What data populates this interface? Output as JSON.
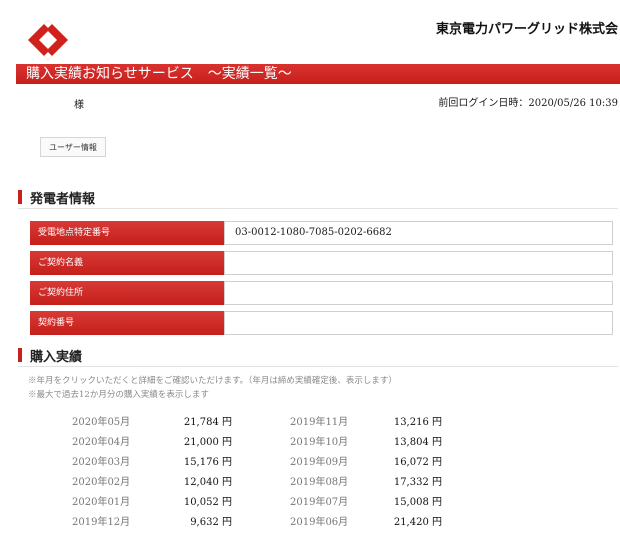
{
  "header": {
    "logo_icon": "tepco-logo-icon",
    "company_name": "東京電力パワーグリッド株式会",
    "brand_color": "#c8201c"
  },
  "banner": {
    "title": "購入実績お知らせサービス　〜実績一覧〜"
  },
  "user": {
    "name_suffix": "様",
    "last_login": "前回ログイン日時：2020/05/26 10:39"
  },
  "nav": {
    "user_info_button": "ユーザー情報"
  },
  "generator_info": {
    "section_title": "発電者情報",
    "rows": [
      {
        "label": "受電地点特定番号",
        "value": "03-0012-1080-7085-0202-6682"
      },
      {
        "label": "ご契約名義",
        "value": ""
      },
      {
        "label": "ご契約住所",
        "value": ""
      },
      {
        "label": "契約番号",
        "value": ""
      }
    ]
  },
  "purchase_results": {
    "section_title": "購入実績",
    "notes": [
      "※年月をクリックいただくと詳細をご確認いただけます。（年月は締め実績確定後、表示します）",
      "※最大で過去12か月分の購入実績を表示します"
    ],
    "unit": "円",
    "left_column": [
      {
        "month": "2020年05月",
        "amount": "21,784"
      },
      {
        "month": "2020年04月",
        "amount": "21,000"
      },
      {
        "month": "2020年03月",
        "amount": "15,176"
      },
      {
        "month": "2020年02月",
        "amount": "12,040"
      },
      {
        "month": "2020年01月",
        "amount": "10,052"
      },
      {
        "month": "2019年12月",
        "amount": "9,632"
      }
    ],
    "right_column": [
      {
        "month": "2019年11月",
        "amount": "13,216"
      },
      {
        "month": "2019年10月",
        "amount": "13,804"
      },
      {
        "month": "2019年09月",
        "amount": "16,072"
      },
      {
        "month": "2019年08月",
        "amount": "17,332"
      },
      {
        "month": "2019年07月",
        "amount": "15,008"
      },
      {
        "month": "2019年06月",
        "amount": "21,420"
      }
    ]
  }
}
